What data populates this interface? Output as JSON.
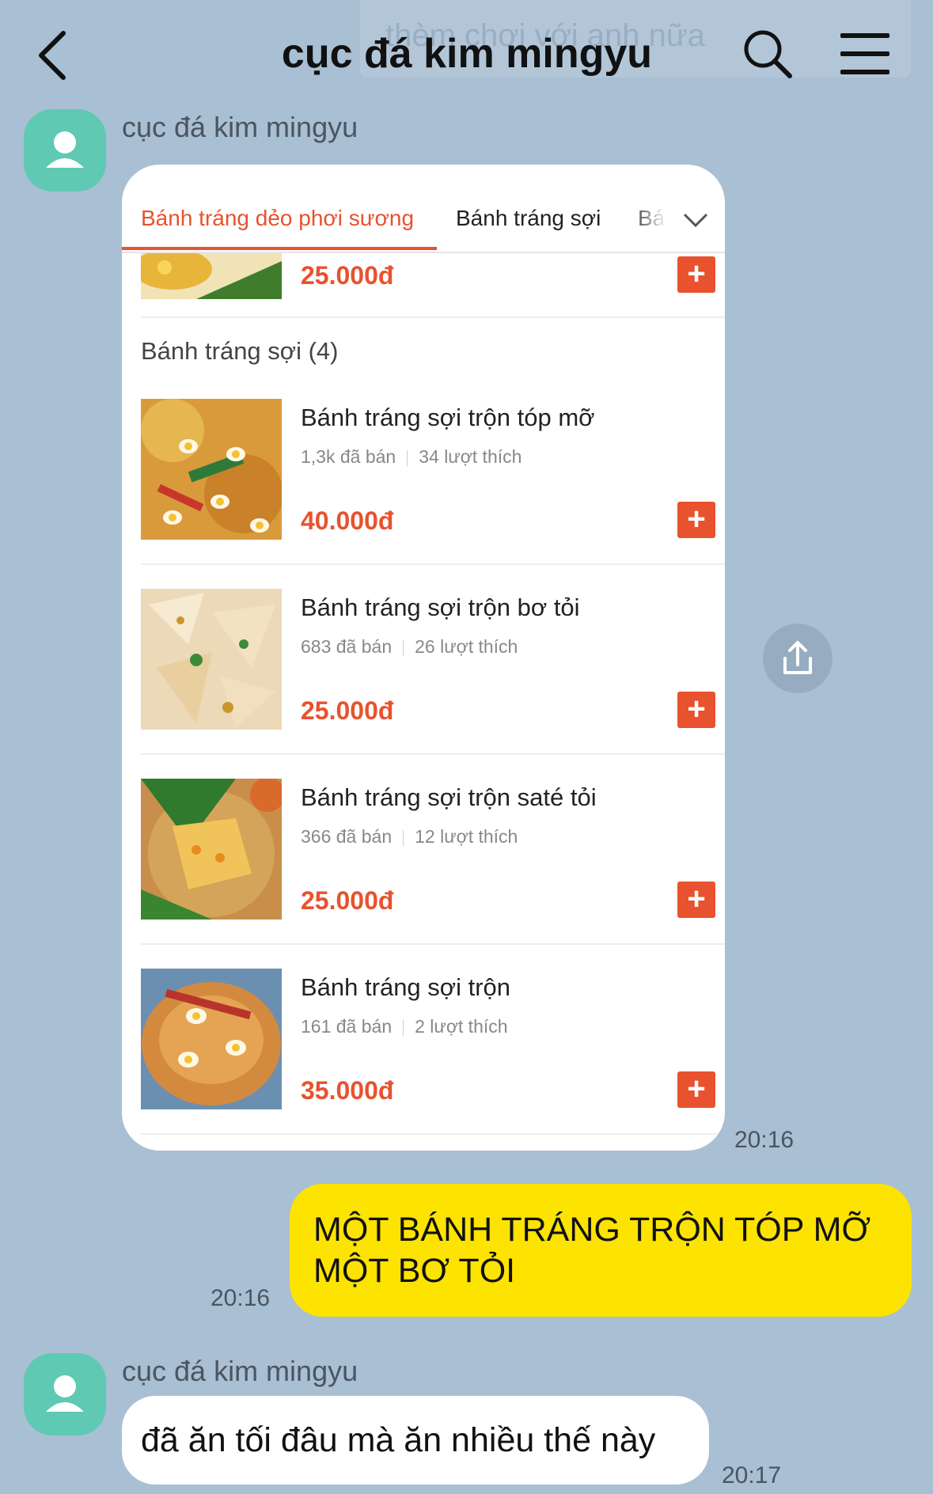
{
  "header": {
    "title": "cục đá kim mingyu",
    "pinned_preview": "thèm chơi với anh nữa"
  },
  "messages": {
    "first": {
      "sender": "cục đá kim mingyu",
      "time": "20:16",
      "card": {
        "tabs": [
          "Bánh tráng dẻo phơi sương",
          "Bánh tráng sợi",
          "Bá"
        ],
        "active_tab": 0,
        "top_partial_price": "25.000đ",
        "section_title": "Bánh tráng sợi (4)",
        "items": [
          {
            "name": "Bánh tráng sợi trộn tóp mỡ",
            "sold": "1,3k đã bán",
            "likes": "34 lượt thích",
            "price": "40.000đ"
          },
          {
            "name": "Bánh tráng sợi trộn bơ tỏi",
            "sold": "683 đã bán",
            "likes": "26 lượt thích",
            "price": "25.000đ"
          },
          {
            "name": "Bánh tráng sợi trộn saté tỏi",
            "sold": "366 đã bán",
            "likes": "12 lượt thích",
            "price": "25.000đ"
          },
          {
            "name": "Bánh tráng sợi trộn",
            "sold": "161 đã bán",
            "likes": "2 lượt thích",
            "price": "35.000đ"
          }
        ],
        "add_label": "+"
      }
    },
    "reply": {
      "text_line1": "MỘT BÁNH TRÁNG TRỘN TÓP MỠ",
      "text_line2": "MỘT BƠ TỎI",
      "time": "20:16"
    },
    "second": {
      "sender": "cục đá kim mingyu",
      "text": "đã ăn tối đâu mà ăn nhiều thế này",
      "time": "20:17"
    }
  },
  "colors": {
    "background": "#a9bfd3",
    "accent": "#e8522e",
    "my_bubble": "#fde300",
    "avatar": "#5fc9b3"
  },
  "icons": [
    "back-arrow-icon",
    "search-icon",
    "menu-icon",
    "chevron-down-icon",
    "share-icon",
    "person-icon"
  ]
}
